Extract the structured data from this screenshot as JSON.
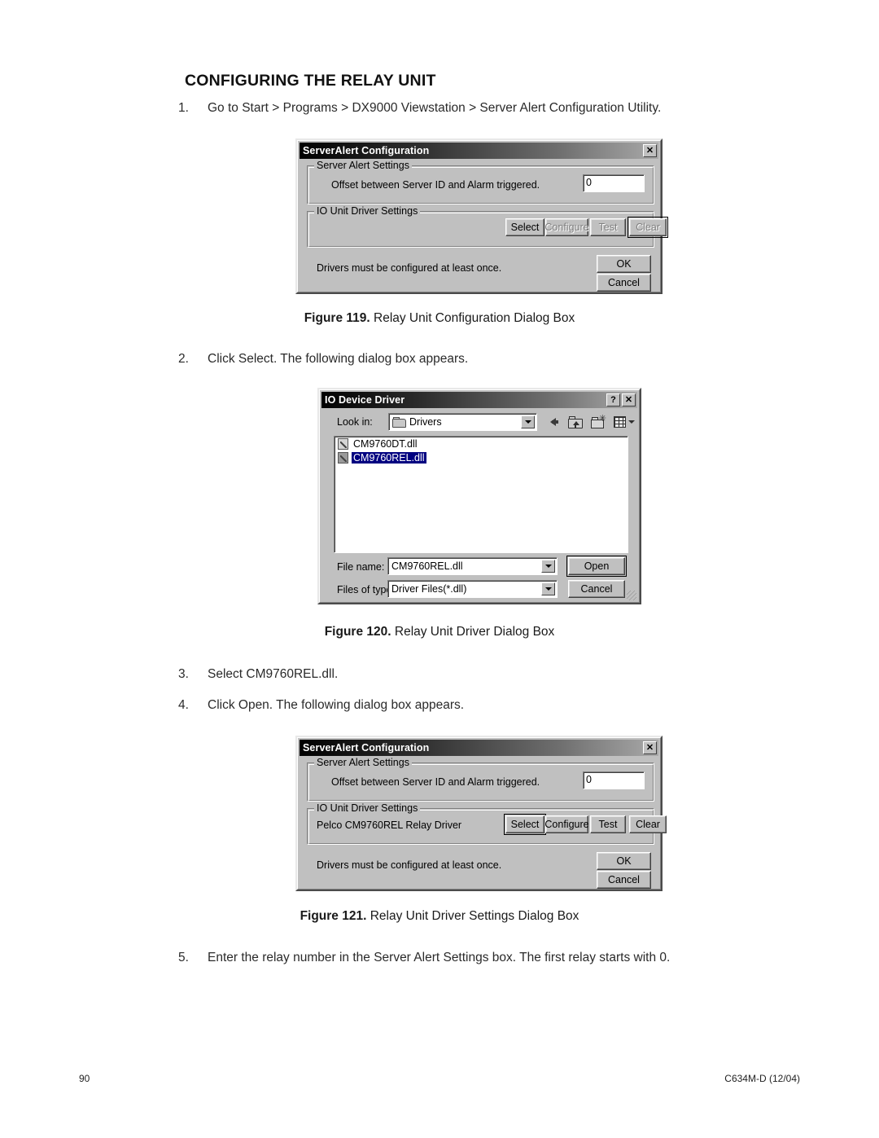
{
  "document": {
    "title": "CONFIGURING THE RELAY UNIT",
    "steps": [
      {
        "num": "1.",
        "text": "Go to Start > Programs > DX9000 Viewstation > Server Alert Configuration Utility."
      },
      {
        "num": "2.",
        "text": "Click Select. The following dialog box appears."
      },
      {
        "num": "3.",
        "text": "Select CM9760REL.dll."
      },
      {
        "num": "4.",
        "text": "Click Open. The following dialog box appears."
      },
      {
        "num": "5.",
        "text": "Enter the relay number in the Server Alert Settings box. The first relay starts with 0."
      }
    ],
    "captions": [
      {
        "label": "Figure 119.",
        "text": "Relay Unit Configuration Dialog Box"
      },
      {
        "label": "Figure 120.",
        "text": "Relay Unit Driver Dialog Box"
      },
      {
        "label": "Figure 121.",
        "text": "Relay Unit Driver Settings Dialog Box"
      }
    ],
    "footer": {
      "page_number": "90",
      "doc_code": "C634M-D (12/04)"
    }
  },
  "dialog_119": {
    "title": "ServerAlert Configuration",
    "close_label": "✕",
    "group_server_alert": {
      "legend": "Server Alert Settings",
      "offset_label": "Offset between Server ID and Alarm triggered.",
      "offset_value": "0"
    },
    "group_io_unit": {
      "legend": "IO Unit Driver Settings",
      "driver_text": "",
      "buttons": [
        {
          "label": "Select",
          "state": "enabled"
        },
        {
          "label": "Configure",
          "state": "disabled"
        },
        {
          "label": "Test",
          "state": "disabled"
        },
        {
          "label": "Clear",
          "state": "disabled-focused"
        }
      ]
    },
    "status_text": "Drivers must be configured at least once.",
    "ok_label": "OK",
    "cancel_label": "Cancel"
  },
  "dialog_120": {
    "title": "IO Device Driver",
    "help_label": "?",
    "close_label": "✕",
    "look_in_label": "Look in:",
    "look_in_value": "Drivers",
    "toolbar_icons": [
      "back-arrow-icon",
      "up-one-level-icon",
      "new-folder-icon",
      "views-menu-icon"
    ],
    "files": [
      {
        "name": "CM9760DT.dll",
        "selected": false
      },
      {
        "name": "CM9760REL.dll",
        "selected": true
      }
    ],
    "file_name_label": "File name:",
    "file_name_value": "CM9760REL.dll",
    "files_of_type_label": "Files of type:",
    "files_of_type_value": "Driver Files(*.dll)",
    "open_label": "Open",
    "cancel_label": "Cancel"
  },
  "dialog_121": {
    "title": "ServerAlert Configuration",
    "close_label": "✕",
    "group_server_alert": {
      "legend": "Server Alert Settings",
      "offset_label": "Offset between Server ID and Alarm triggered.",
      "offset_value": "0"
    },
    "group_io_unit": {
      "legend": "IO Unit Driver Settings",
      "driver_text": "Pelco CM9760REL Relay Driver",
      "buttons": [
        {
          "label": "Select",
          "state": "enabled-focused"
        },
        {
          "label": "Configure",
          "state": "enabled"
        },
        {
          "label": "Test",
          "state": "enabled"
        },
        {
          "label": "Clear",
          "state": "enabled"
        }
      ]
    },
    "status_text": "Drivers must be configured at least once.",
    "ok_label": "OK",
    "cancel_label": "Cancel"
  }
}
